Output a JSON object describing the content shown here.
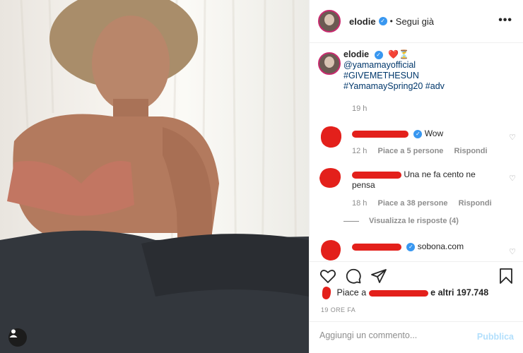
{
  "header": {
    "username": "elodie",
    "separator": "•",
    "follow_label": "Segui già",
    "more_label": "•••"
  },
  "caption": {
    "username": "elodie",
    "emoji": "❤️⏳",
    "mention": "@yamamayofficial",
    "hashtag1": "#GIVEMETHESUN",
    "hashtag2": "#YamamaySpring20 #adv",
    "time": "19 h"
  },
  "comments": [
    {
      "text": "Wow",
      "time": "12 h",
      "likes": "Piace a 5 persone",
      "reply": "Rispondi"
    },
    {
      "text": "Una ne fa cento ne pensa",
      "time": "18 h",
      "likes": "Piace a 38 persone",
      "reply": "Rispondi",
      "view_replies": "Visualizza le risposte (4)"
    },
    {
      "text": "sobona.com"
    }
  ],
  "likes": {
    "prefix": "Piace a",
    "suffix": "e altri 197.748"
  },
  "post_date": "19 ORE FA",
  "add_comment": {
    "placeholder": "Aggiungi un commento...",
    "publish_label": "Pubblica"
  },
  "colors": {
    "link": "#00376b",
    "verified": "#3897f0",
    "redaction": "#e3201b",
    "publish_disabled": "#b2dffc"
  }
}
